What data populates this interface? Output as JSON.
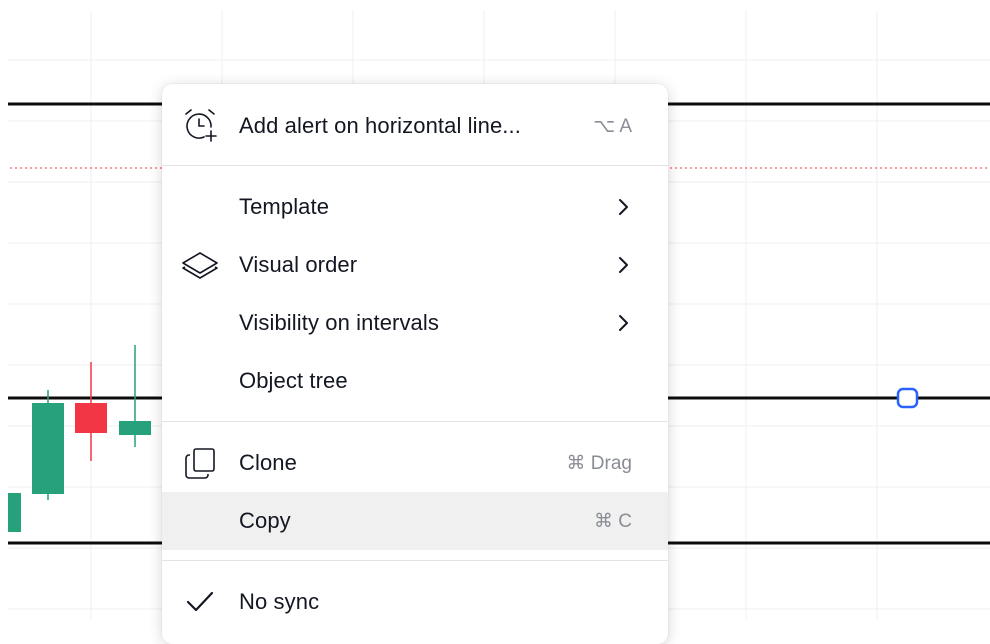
{
  "colors": {
    "candle_up": "#26a17b",
    "candle_down": "#f23645",
    "line": "#0c0c0c",
    "handle": "#2962ff",
    "alert_dotted": "#f23645"
  },
  "context_menu": {
    "items": [
      {
        "label": "Add alert on horizontal line...",
        "shortcut": "⌥ A",
        "icon": "alarm-clock-plus-icon"
      },
      {
        "label": "Template",
        "icon": "chevron-right-icon"
      },
      {
        "label": "Visual order",
        "icon": "layers-icon"
      },
      {
        "label": "Visibility on intervals",
        "icon": "chevron-right-icon"
      },
      {
        "label": "Object tree"
      },
      {
        "label": "Clone",
        "shortcut": "⌘ Drag",
        "icon": "clone-icon"
      },
      {
        "label": "Copy",
        "shortcut": "⌘ C"
      },
      {
        "label": "No sync",
        "icon": "checkmark-icon",
        "checked": true
      }
    ]
  }
}
